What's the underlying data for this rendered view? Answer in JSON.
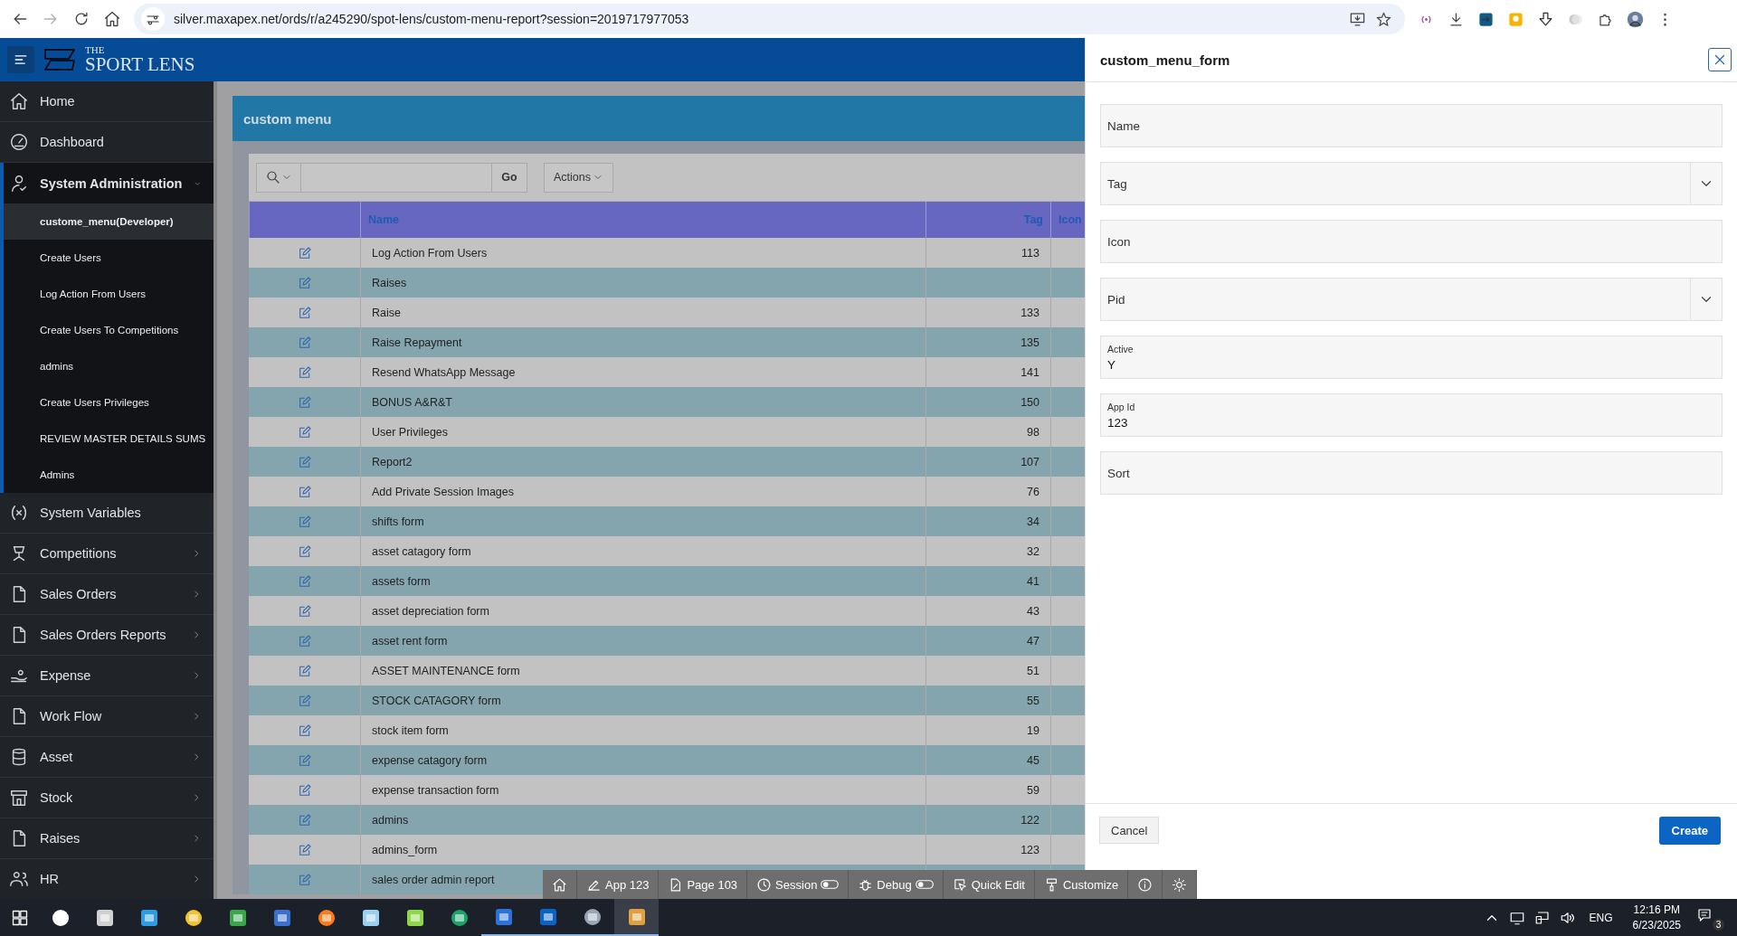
{
  "browser": {
    "url": "silver.maxapex.net/ords/r/a245290/spot-lens/custom-menu-report?session=2019717977053",
    "forward_enabled": false
  },
  "header": {
    "logo_small": "THE",
    "logo_big": "SPORT LENS"
  },
  "sidebar": {
    "items": [
      {
        "label": "Home"
      },
      {
        "label": "Dashboard"
      },
      {
        "label": "System Administration",
        "expanded": true,
        "children": [
          {
            "label": "custome_menu(Developer)",
            "selected": true
          },
          {
            "label": "Create Users",
            "selected": false
          },
          {
            "label": "Log Action From Users",
            "selected": false
          },
          {
            "label": "Create Users To Competitions",
            "selected": false
          },
          {
            "label": "admins",
            "selected": false
          },
          {
            "label": "Create Users Privileges",
            "selected": false
          },
          {
            "label": "REVIEW MASTER DETAILS SUMS",
            "selected": false
          },
          {
            "label": "Admins",
            "selected": false
          }
        ]
      },
      {
        "label": "System Variables"
      },
      {
        "label": "Competitions",
        "expanded": false
      },
      {
        "label": "Sales Orders",
        "expanded": false
      },
      {
        "label": "Sales Orders Reports",
        "expanded": false
      },
      {
        "label": "Expense",
        "expanded": false
      },
      {
        "label": "Work Flow",
        "expanded": false
      },
      {
        "label": "Asset",
        "expanded": false
      },
      {
        "label": "Stock",
        "expanded": false
      },
      {
        "label": "Raises",
        "expanded": false
      },
      {
        "label": "HR",
        "expanded": false
      }
    ]
  },
  "region": {
    "title": "custom menu",
    "go_button": "Go",
    "actions_button": "Actions"
  },
  "table": {
    "columns": [
      {
        "label": "Name"
      },
      {
        "label": "Tag"
      },
      {
        "label": "Icon"
      }
    ],
    "rows": [
      {
        "name": "Log Action From Users",
        "tag": "113"
      },
      {
        "name": "Raises"
      },
      {
        "name": "Raise",
        "tag": "133"
      },
      {
        "name": "Raise Repayment",
        "tag": "135"
      },
      {
        "name": "Resend WhatsApp Message",
        "tag": "141"
      },
      {
        "name": "BONUS A&R&T",
        "tag": "150"
      },
      {
        "name": "User Privileges",
        "tag": "98"
      },
      {
        "name": "Report2",
        "tag": "107"
      },
      {
        "name": "Add Private Session Images",
        "tag": "76"
      },
      {
        "name": "shifts form",
        "tag": "34"
      },
      {
        "name": "asset catagory form",
        "tag": "32"
      },
      {
        "name": "assets form",
        "tag": "41"
      },
      {
        "name": "asset depreciation form",
        "tag": "43"
      },
      {
        "name": "asset rent form",
        "tag": "47"
      },
      {
        "name": "ASSET MAINTENANCE form",
        "tag": "51"
      },
      {
        "name": "STOCK CATAGORY form",
        "tag": "55"
      },
      {
        "name": "stock item form",
        "tag": "19"
      },
      {
        "name": "expense catagory form",
        "tag": "45"
      },
      {
        "name": "expense transaction form",
        "tag": "59"
      },
      {
        "name": "admins",
        "tag": "122"
      },
      {
        "name": "admins_form",
        "tag": "123"
      },
      {
        "name": "sales order admin report"
      }
    ]
  },
  "dialog": {
    "title": "custom_menu_form",
    "fields": [
      {
        "label": "Name",
        "kind": "text"
      },
      {
        "label": "Tag",
        "kind": "select"
      },
      {
        "label": "Icon",
        "kind": "text"
      },
      {
        "label": "Pid",
        "kind": "select"
      },
      {
        "label": "Active",
        "kind": "text",
        "value": "Y"
      },
      {
        "label": "App Id",
        "kind": "text",
        "value": "123"
      },
      {
        "label": "Sort",
        "kind": "text"
      }
    ],
    "cancel_button": "Cancel",
    "create_button": "Create"
  },
  "dev_toolbar": [
    {
      "kind": "icon"
    },
    {
      "kind": "link",
      "label": "App 123"
    },
    {
      "kind": "link",
      "label": "Page 103"
    },
    {
      "kind": "toggle",
      "label": "Session",
      "on": false
    },
    {
      "kind": "toggle",
      "label": "Debug",
      "on": false
    },
    {
      "kind": "link",
      "label": "Quick Edit"
    },
    {
      "kind": "link",
      "label": "Customize"
    },
    {
      "kind": "icon"
    },
    {
      "kind": "icon"
    }
  ],
  "taskbar": {
    "apps": [
      {
        "running": false,
        "active": false
      },
      {
        "running": false,
        "active": false
      },
      {
        "running": false,
        "active": false
      },
      {
        "running": false,
        "active": false
      },
      {
        "running": false,
        "active": false
      },
      {
        "running": false,
        "active": false
      },
      {
        "running": false,
        "active": false
      },
      {
        "running": false,
        "active": false
      },
      {
        "running": false,
        "active": false
      },
      {
        "running": false,
        "active": false
      },
      {
        "running": true,
        "active": false
      },
      {
        "running": true,
        "active": false
      },
      {
        "running": true,
        "active": false
      },
      {
        "running": true,
        "active": true
      }
    ],
    "language": "ENG",
    "time": "12:16 PM",
    "date": "6/23/2025",
    "notifications": "3"
  }
}
